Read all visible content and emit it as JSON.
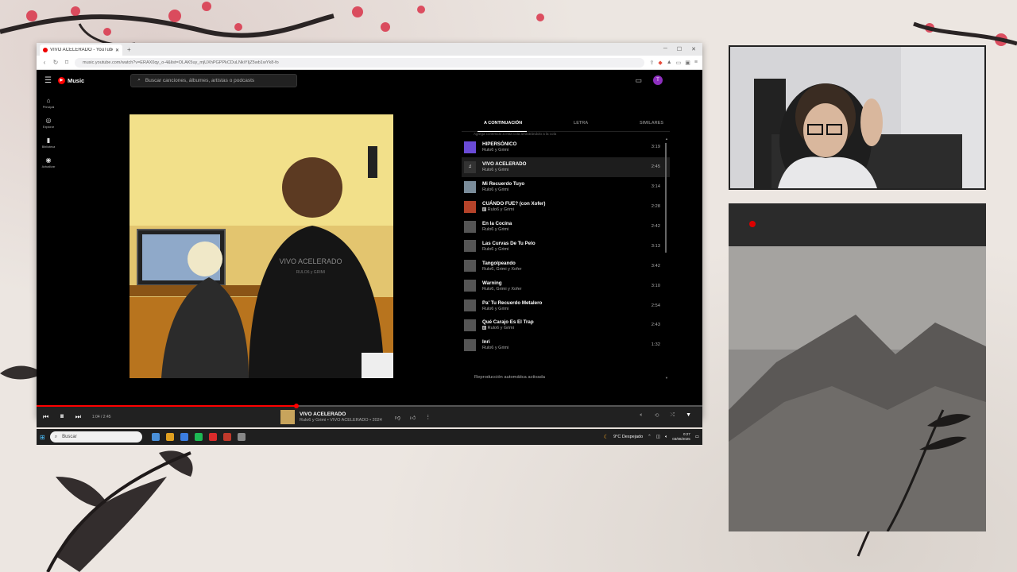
{
  "browser": {
    "tab_title": "VIVO ACELERADO - YouTube",
    "url": "music.youtube.com/watch?v=ERAX0qy_o-4&list=OLAK5uy_mjUXhPGPPkCDuLNkiYIjZ5wb1wYk8-fo"
  },
  "app": {
    "logo_text": "Music",
    "search_placeholder": "Buscar canciones, álbumes, artistas o podcasts",
    "avatar_letter": "T"
  },
  "sidebar": {
    "items": [
      {
        "label": "Principal",
        "icon": "home-icon"
      },
      {
        "label": "Explorar",
        "icon": "compass-icon"
      },
      {
        "label": "Biblioteca",
        "icon": "library-icon"
      },
      {
        "label": "Actualizar",
        "icon": "upgrade-icon"
      }
    ]
  },
  "queue": {
    "tabs": [
      "A CONTINUACIÓN",
      "LETRA",
      "SIMILARES"
    ],
    "hint": "Agrega contenido a esta cola arrastrándolo a la cola",
    "items": [
      {
        "title": "HIPERSÓNICO",
        "artist": "Rulo6 y Grimi",
        "duration": "3:19",
        "explicit": false,
        "current": false,
        "thumb": "#6a4bd6"
      },
      {
        "title": "VIVO ACELERADO",
        "artist": "Rulo6 y Grimi",
        "duration": "2:45",
        "explicit": false,
        "current": true,
        "thumb": "#333333"
      },
      {
        "title": "Mi Recuerdo Tuyo",
        "artist": "Rulo6 y Grimi",
        "duration": "3:14",
        "explicit": false,
        "current": false,
        "thumb": "#7a8c9a"
      },
      {
        "title": "CUÁNDO FUE? (con Xofer)",
        "artist": "Rulo6 y Grimi",
        "duration": "2:28",
        "explicit": true,
        "current": false,
        "thumb": "#b5432a"
      },
      {
        "title": "En la Cocina",
        "artist": "Rulo6 y Grimi",
        "duration": "2:42",
        "explicit": false,
        "current": false,
        "thumb": "#555555"
      },
      {
        "title": "Las Curvas De Tu Pelo",
        "artist": "Rulo6 y Grimi",
        "duration": "3:13",
        "explicit": false,
        "current": false,
        "thumb": "#555555"
      },
      {
        "title": "Tangolpeando",
        "artist": "Rulo6, Grimi y Xofer",
        "duration": "3:42",
        "explicit": false,
        "current": false,
        "thumb": "#555555"
      },
      {
        "title": "Warning",
        "artist": "Rulo6, Grimi y Xofer",
        "duration": "3:10",
        "explicit": false,
        "current": false,
        "thumb": "#555555"
      },
      {
        "title": "Pa' Tu Recuerdo Metalero",
        "artist": "Rulo6 y Grimi",
        "duration": "2:54",
        "explicit": false,
        "current": false,
        "thumb": "#555555"
      },
      {
        "title": "Qué Carajo Es El Trap",
        "artist": "Rulo6 y Grimi",
        "duration": "2:43",
        "explicit": true,
        "current": false,
        "thumb": "#555555"
      },
      {
        "title": "Inri",
        "artist": "Rulo6 y Grimi",
        "duration": "1:32",
        "explicit": false,
        "current": false,
        "thumb": "#555555"
      }
    ],
    "autoplay": "Reproducción automática activada"
  },
  "artwork": {
    "shirt_text": "VIVO ACELERADO",
    "shirt_sub": "RULO6 y GRIMI"
  },
  "player": {
    "time": "1:04 / 2:45",
    "progress": 0.39,
    "title": "VIVO ACELERADO",
    "subtitle": "Rulo6 y Grimi • VIVO ACELERADO • 2024"
  },
  "taskbar": {
    "search_label": "Buscar",
    "weather": "9°C Despejado",
    "time": "0:27",
    "date": "03/08/2025",
    "app_colors": [
      "#4a90d9",
      "#e0a020",
      "#3b7de0",
      "#1db954",
      "#d92b2b",
      "#c0392b",
      "#888888"
    ]
  }
}
